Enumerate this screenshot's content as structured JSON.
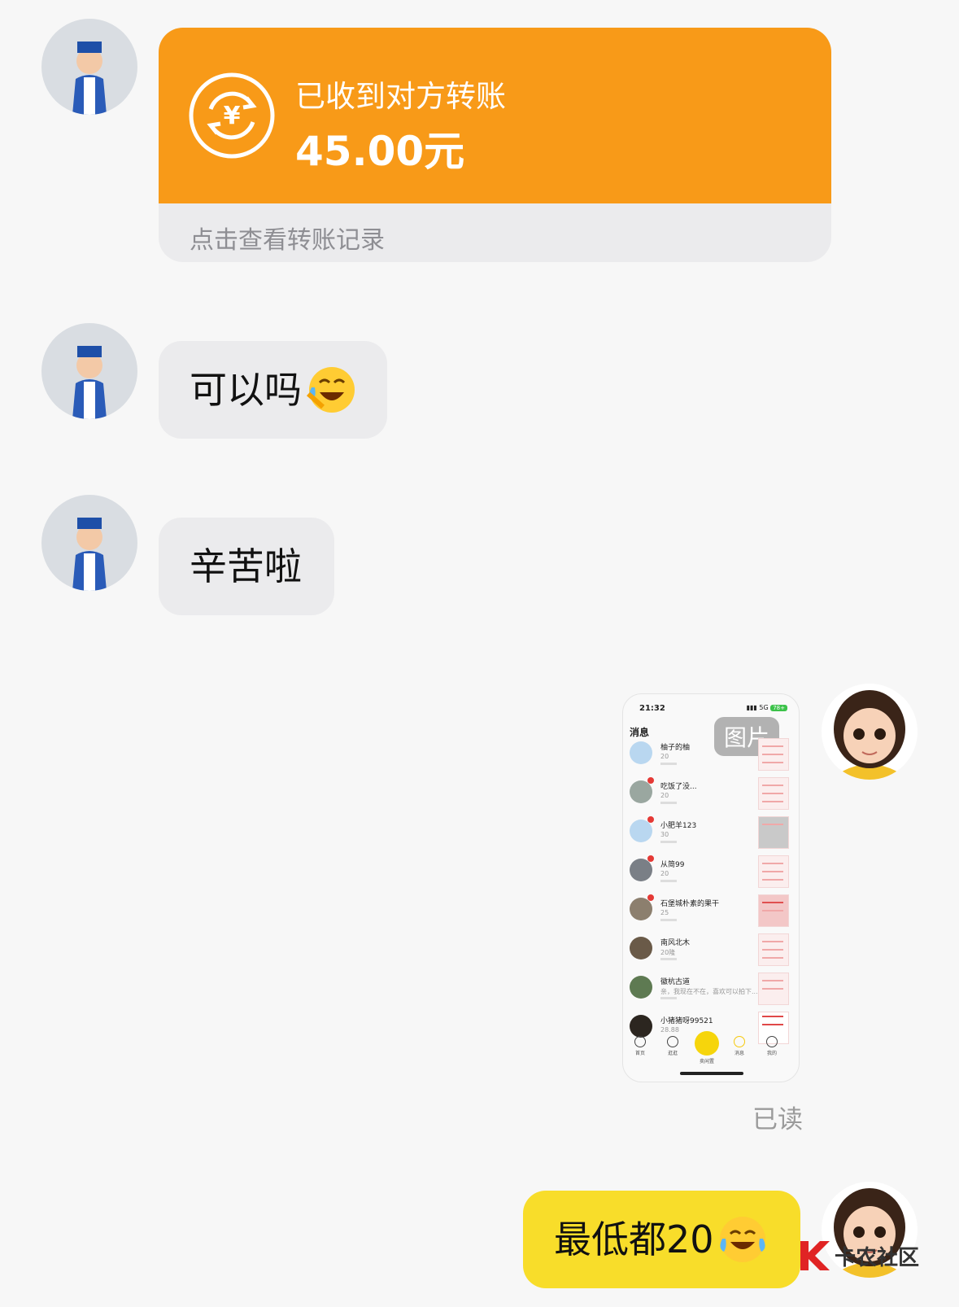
{
  "colors": {
    "background": "#f7f7f7",
    "transfer_orange": "#f89a18",
    "received_bubble": "#ebebed",
    "sent_bubble": "#f8dd2a",
    "read_text": "#9b9b9b"
  },
  "messages": {
    "transfer": {
      "title": "已收到对方转账",
      "amount": "45.00元",
      "footer_link": "点击查看转账记录",
      "icon": "yuan-exchange-icon"
    },
    "msg1": {
      "text": "可以吗",
      "emoji": "crying-laughing-face-emoji"
    },
    "msg2": {
      "text": "辛苦啦"
    },
    "image_msg": {
      "badge": "图片",
      "screenshot": {
        "time": "21:32",
        "signal": "5G",
        "battery": "78+",
        "title": "消息",
        "rows": [
          {
            "name": "柚子的柚",
            "sub": "20"
          },
          {
            "name": "吃饭了没...",
            "sub": "20"
          },
          {
            "name": "小肥羊123",
            "sub": "30"
          },
          {
            "name": "从简99",
            "sub": "20"
          },
          {
            "name": "石堡城朴素的果干",
            "sub": "25"
          },
          {
            "name": "南风北木",
            "sub": "20隆"
          },
          {
            "name": "徽杭古道",
            "sub": "亲，我现在不在，喜欢可以拍下..."
          },
          {
            "name": "小猪猪呀99521",
            "sub": "28.88"
          }
        ],
        "nav": [
          "首页",
          "逛逛",
          "卖闲置",
          "消息",
          "我的"
        ]
      }
    },
    "read_status": "已读",
    "msg_sent": {
      "text": "最低都20",
      "emoji": "crying-laughing-face-emoji"
    }
  },
  "watermark": {
    "text": "卡农社区",
    "logo": "k-logo-icon"
  }
}
